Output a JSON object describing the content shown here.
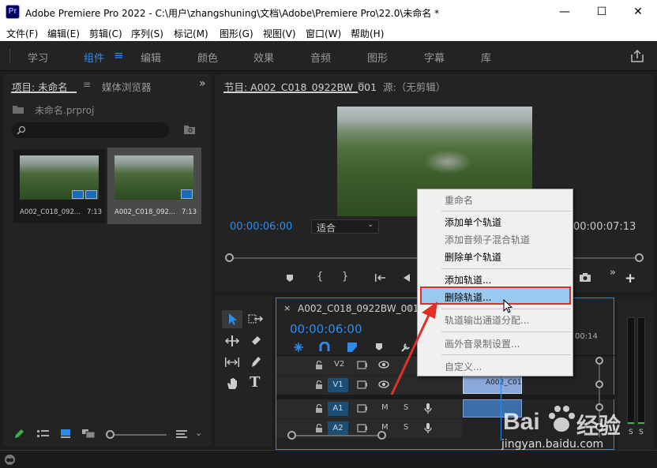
{
  "window": {
    "app_icon": "Pr",
    "title": "Adobe Premiere Pro 2022 - C:\\用户\\zhangshuning\\文档\\Adobe\\Premiere Pro\\22.0\\未命名 *",
    "minimize": "—",
    "maximize": "☐",
    "close": "✕"
  },
  "menu": [
    "文件(F)",
    "编辑(E)",
    "剪辑(C)",
    "序列(S)",
    "标记(M)",
    "图形(G)",
    "视图(V)",
    "窗口(W)",
    "帮助(H)"
  ],
  "workspaces": {
    "items": [
      "学习",
      "组件",
      "编辑",
      "颜色",
      "效果",
      "音频",
      "图形",
      "字幕",
      "库"
    ],
    "active": "组件",
    "menu_icon": "≡",
    "share_icon": "share-icon"
  },
  "project": {
    "tab_project": "项目: 未命名",
    "tab_media": "媒体浏览器",
    "more": "»",
    "project_file": "未命名.prproj",
    "search_placeholder": "",
    "clips": [
      {
        "name": "A002_C018_092...",
        "duration": "7:13"
      },
      {
        "name": "A002_C018_092...",
        "duration": "7:13"
      }
    ]
  },
  "program": {
    "tab_program": "节目: A002_C018_0922BW_001",
    "tab_source": "源:（无剪辑）",
    "timecode": "00:00:06:00",
    "fit": "适合",
    "duration": "00:00:07:13"
  },
  "timeline": {
    "tab": "A002_C018_0922BW_001",
    "timecode": "00:00:06:00",
    "ruler_label": "00:14",
    "tracks": [
      {
        "name": "V2",
        "type": "video"
      },
      {
        "name": "V1",
        "type": "video",
        "target": "V1"
      },
      {
        "name": "A1",
        "type": "audio",
        "target": "A1",
        "m": "M",
        "s": "S"
      },
      {
        "name": "A2",
        "type": "audio",
        "target": "A2",
        "m": "M",
        "s": "S"
      }
    ],
    "clip_label": "A002_C01",
    "meter_labels": [
      "S",
      "S"
    ]
  },
  "context_menu": {
    "items": [
      {
        "label": "重命名",
        "disabled": true
      },
      {
        "label": "添加单个轨道",
        "disabled": false
      },
      {
        "label": "添加音频子混合轨道",
        "disabled": true
      },
      {
        "label": "删除单个轨道",
        "disabled": false
      },
      {
        "label": "添加轨道...",
        "disabled": false
      },
      {
        "label": "删除轨道...",
        "disabled": false,
        "highlighted": true
      },
      {
        "label": "轨道输出通道分配...",
        "disabled": true
      },
      {
        "label": "画外音录制设置...",
        "disabled": true
      },
      {
        "label": "自定义...",
        "disabled": true
      }
    ]
  },
  "watermark": {
    "brand": "Bai",
    "brand2": "经验",
    "url": "jingyan.baidu.com"
  },
  "colors": {
    "accent": "#2d8ceb",
    "highlight_border": "#e0302a",
    "highlight_fill": "#99c9ef"
  }
}
